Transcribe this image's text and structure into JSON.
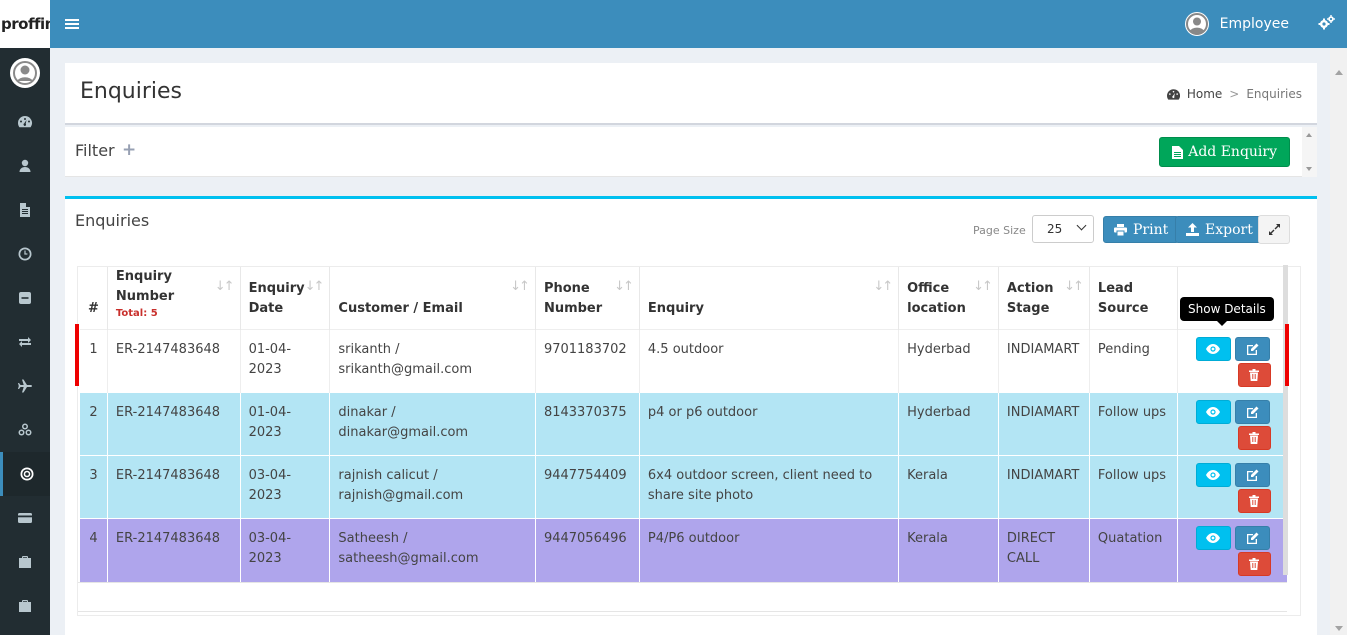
{
  "app": {
    "logo_text": "proffin",
    "user_name": "Employee"
  },
  "sidebar": {
    "items": [
      {
        "icon": "dashboard-icon"
      },
      {
        "icon": "user-icon"
      },
      {
        "icon": "document-icon"
      },
      {
        "icon": "clock-icon"
      },
      {
        "icon": "minus-square-icon"
      },
      {
        "icon": "exchange-icon"
      },
      {
        "icon": "plane-icon"
      },
      {
        "icon": "cubes-icon"
      },
      {
        "icon": "bullseye-icon",
        "active": true
      },
      {
        "icon": "credit-card-icon"
      },
      {
        "icon": "briefcase-icon"
      },
      {
        "icon": "briefcase-icon"
      }
    ]
  },
  "header": {
    "title": "Enquiries",
    "breadcrumb": {
      "home": "Home",
      "current": "Enquiries"
    }
  },
  "filter": {
    "title": "Filter",
    "plus": "+",
    "add_label": "Add Enquiry"
  },
  "main": {
    "title": "Enquiries",
    "page_size_label": "Page Size",
    "page_size_value": "25",
    "print_label": "Print",
    "export_label": "Export",
    "tooltip": "Show Details"
  },
  "table": {
    "columns": {
      "num": "#",
      "enquiry_number": "Enquiry Number",
      "total": "Total: 5",
      "enquiry_date_1": "Enquiry",
      "enquiry_date_2": "Date",
      "customer": "Customer / Email",
      "phone_1": "Phone",
      "phone_2": "Number",
      "enquiry": "Enquiry",
      "office_1": "Office",
      "office_2": "location",
      "action_1": "Action",
      "action_2": "Stage",
      "lead_1": "Lead",
      "lead_2": "Source"
    },
    "rows": [
      {
        "num": "1",
        "enquiry_number": "ER-2147483648",
        "date": "01-04-2023",
        "customer": "srikanth / srikanth@gmail.com",
        "phone": "9701183702",
        "enquiry": "4.5 outdoor",
        "office": "Hyderbad",
        "stage": "INDIAMART",
        "source": "Pending"
      },
      {
        "num": "2",
        "enquiry_number": "ER-2147483648",
        "date": "01-04-2023",
        "customer": "dinakar / dinakar@gmail.com",
        "phone": "8143370375",
        "enquiry": "p4 or p6 outdoor",
        "office": "Hyderbad",
        "stage": "INDIAMART",
        "source": "Follow ups"
      },
      {
        "num": "3",
        "enquiry_number": "ER-2147483648",
        "date": "03-04-2023",
        "customer": "rajnish calicut / rajnish@gmail.com",
        "phone": "9447754409",
        "enquiry": "6x4 outdoor screen, client need to share site photo",
        "office": "Kerala",
        "stage": "INDIAMART",
        "source": "Follow ups"
      },
      {
        "num": "4",
        "enquiry_number": "ER-2147483648",
        "date": "03-04-2023",
        "customer": "Satheesh / satheesh@gmail.com",
        "phone": "9447056496",
        "enquiry": "P4/P6 outdoor",
        "office": "Kerala",
        "stage": "DIRECT CALL",
        "source": "Quatation"
      }
    ]
  }
}
